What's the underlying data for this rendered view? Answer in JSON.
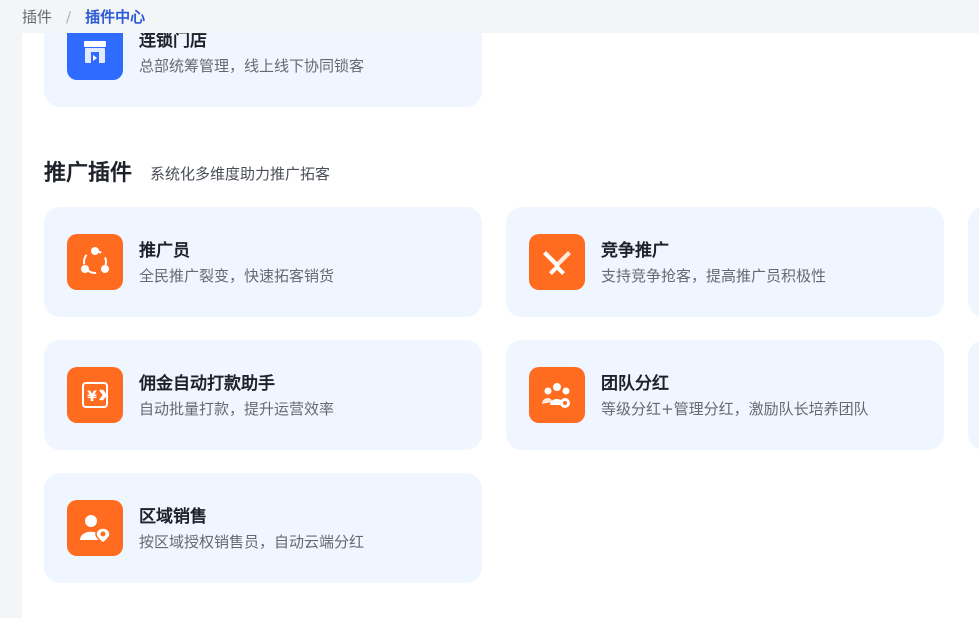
{
  "breadcrumb": {
    "root": "插件",
    "separator": "/",
    "current": "插件中心"
  },
  "store_plugin": {
    "title": "连锁门店",
    "desc": "总部统筹管理，线上线下协同锁客",
    "icon": "store-icon"
  },
  "section": {
    "title": "推广插件",
    "subtitle": "系统化多维度助力推广拓客"
  },
  "plugins": [
    {
      "title": "推广员",
      "desc": "全民推广裂变，快速拓客销货",
      "icon": "share-network-icon"
    },
    {
      "title": "竞争推广",
      "desc": "支持竞争抢客，提高推广员积极性",
      "icon": "crossed-swords-icon"
    },
    {
      "title": "佣金自动打款助手",
      "desc": "自动批量打款，提升运营效率",
      "icon": "yen-payment-icon"
    },
    {
      "title": "团队分红",
      "desc": "等级分红+管理分红，激励队长培养团队",
      "icon": "team-icon"
    },
    {
      "title": "区域销售",
      "desc": "按区域授权销售员，自动云端分红",
      "icon": "user-location-icon"
    }
  ],
  "colors": {
    "accent": "#2b5bd7",
    "icon_orange": "#ff6b1f",
    "icon_blue": "#2f6bff",
    "card_bg": "#f0f6ff"
  }
}
